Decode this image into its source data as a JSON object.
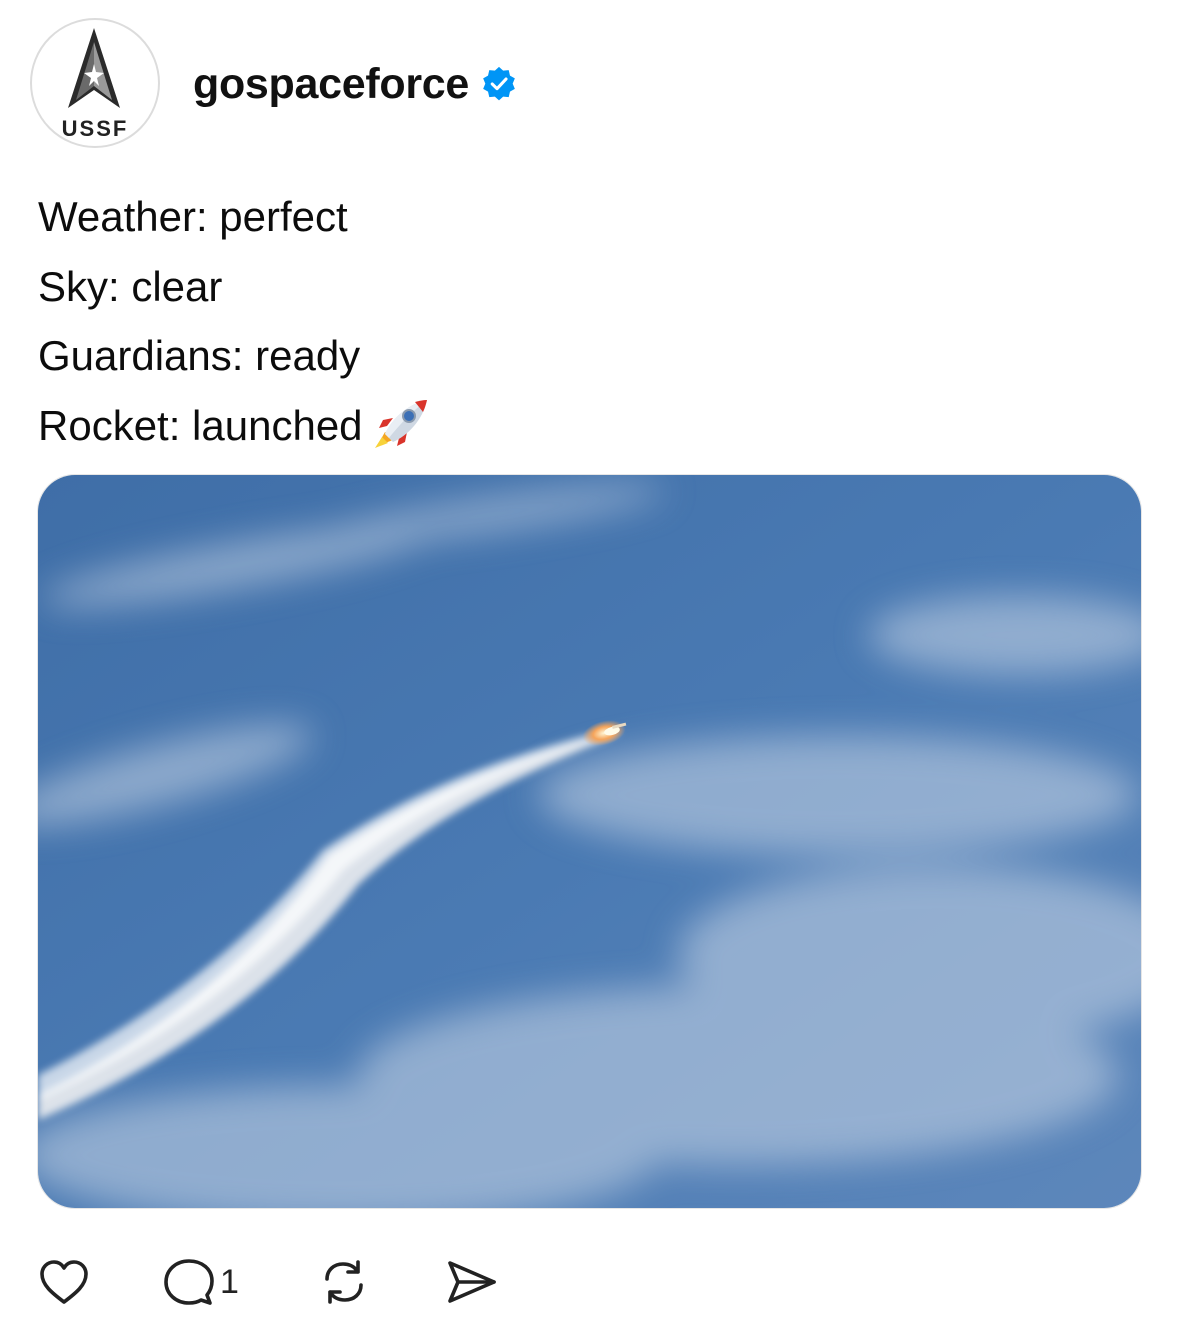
{
  "post": {
    "avatar": {
      "icon": "ussf-delta-logo-icon",
      "text": "USSF"
    },
    "username": "gospaceforce",
    "verified_icon": "verified-badge-icon",
    "verified_color": "#0095f6",
    "caption_lines": [
      "Weather: perfect",
      "Sky: clear",
      "Guardians: ready",
      "Rocket: launched"
    ],
    "caption_emoji": "rocket-emoji",
    "media": {
      "type": "photo",
      "subject": "rocket-launch-photo"
    }
  },
  "actions": {
    "like_icon": "heart-icon",
    "comment_icon": "comment-icon",
    "comment_count": "1",
    "repost_icon": "repost-icon",
    "share_icon": "share-icon"
  }
}
